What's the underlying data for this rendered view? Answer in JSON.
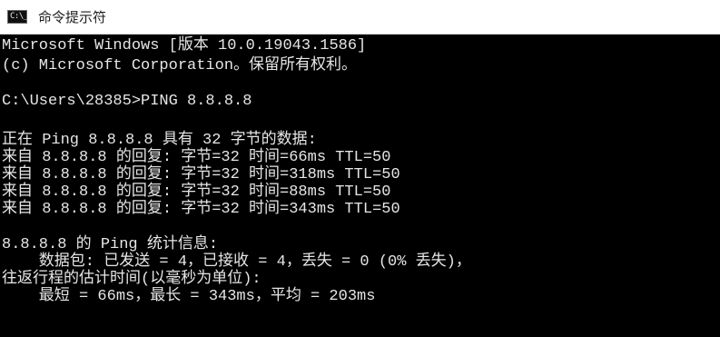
{
  "window": {
    "title": "命令提示符",
    "icon": "cmd-app-icon",
    "icon_glyph": "C:\\_"
  },
  "console": {
    "lines": [
      "Microsoft Windows [版本 10.0.19043.1586]",
      "(c) Microsoft Corporation。保留所有权利。",
      "",
      "C:\\Users\\28385>PING 8.8.8.8",
      "",
      "正在 Ping 8.8.8.8 具有 32 字节的数据:",
      "来自 8.8.8.8 的回复: 字节=32 时间=66ms TTL=50",
      "来自 8.8.8.8 的回复: 字节=32 时间=318ms TTL=50",
      "来自 8.8.8.8 的回复: 字节=32 时间=88ms TTL=50",
      "来自 8.8.8.8 的回复: 字节=32 时间=343ms TTL=50",
      "",
      "8.8.8.8 的 Ping 统计信息:",
      "    数据包: 已发送 = 4，已接收 = 4，丢失 = 0 (0% 丢失)，",
      "往返行程的估计时间(以毫秒为单位):",
      "    最短 = 66ms，最长 = 343ms，平均 = 203ms"
    ]
  },
  "colors": {
    "console_background": "#000000",
    "console_text": "#e6e6e6",
    "titlebar_background": "#ffffff"
  }
}
